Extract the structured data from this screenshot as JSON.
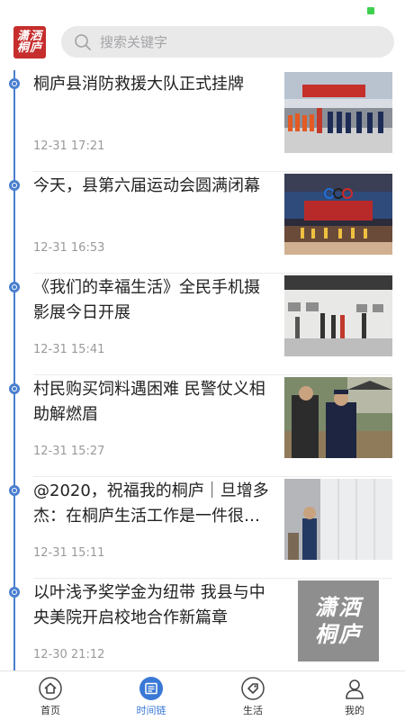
{
  "header": {
    "logo_text": "潇洒桐庐",
    "search_placeholder": "搜索关键字"
  },
  "feed": [
    {
      "title": "桐庐县消防救援大队正式挂牌",
      "time": "12-31 17:21",
      "image": "fire-brigade-ceremony-photo"
    },
    {
      "title": "今天，县第六届运动会圆满闭幕",
      "time": "12-31 16:53",
      "image": "sports-closing-ceremony-photo"
    },
    {
      "title": "《我们的幸福生活》全民手机摄影展今日开展",
      "time": "12-31 15:41",
      "image": "photo-exhibition-photo"
    },
    {
      "title": "村民购买饲料遇困难  民警仗义相助解燃眉",
      "time": "12-31 15:27",
      "image": "police-helping-villager-photo"
    },
    {
      "title": "@2020，祝福我的桐庐｜旦增多杰：在桐庐生活工作是一件很…",
      "time": "12-31 15:11",
      "image": "worker-indoors-photo"
    },
    {
      "title": "以叶浅予奖学金为纽带  我县与中央美院开启校地合作新篇章",
      "time": "12-30 21:12",
      "image": "xiaosa-tonglu-logo-placeholder",
      "placeholder_text": "潇洒桐庐"
    }
  ],
  "tabbar": {
    "tabs": [
      {
        "label": "首页",
        "icon": "home-icon"
      },
      {
        "label": "时间链",
        "icon": "newspaper-icon",
        "active": true
      },
      {
        "label": "生活",
        "icon": "tag-icon"
      },
      {
        "label": "我的",
        "icon": "user-icon"
      }
    ]
  },
  "colors": {
    "accent": "#4a7fcf",
    "tab_active": "#3a78d6",
    "logo_red": "#c62d2d"
  }
}
